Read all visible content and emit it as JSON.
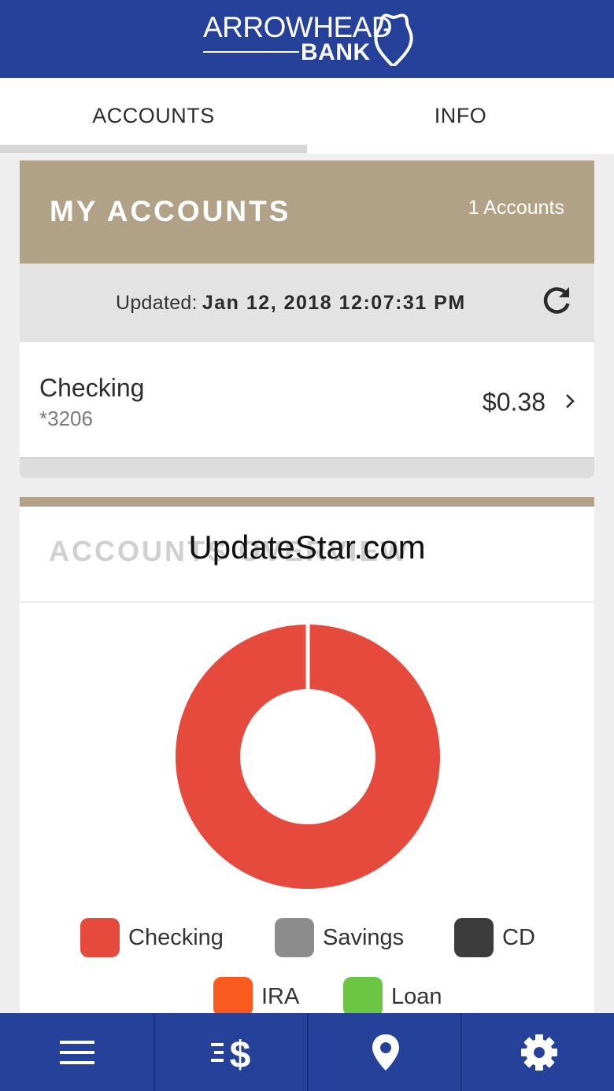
{
  "brand": {
    "name_top": "ARROWHEAD",
    "name_bottom": "BANK",
    "color": "#26419a",
    "accent": "#b1a287"
  },
  "tabs": [
    {
      "label": "ACCOUNTS",
      "active": true
    },
    {
      "label": "INFO",
      "active": false
    }
  ],
  "my_accounts": {
    "title": "MY ACCOUNTS",
    "count": "1 Accounts",
    "updated_label": "Updated:",
    "updated_value": "Jan 12, 2018 12:07:31 PM",
    "refresh_icon": "refresh-icon",
    "accounts": [
      {
        "name": "Checking",
        "number": "*3206",
        "balance": "$0.38"
      }
    ]
  },
  "overview": {
    "title": "ACCOUNTS OVERVIEW",
    "legend": [
      {
        "label": "Checking",
        "color": "#e64a3c"
      },
      {
        "label": "Savings",
        "color": "#8c8c8c"
      },
      {
        "label": "CD",
        "color": "#3c3c3c"
      },
      {
        "label": "IRA",
        "color": "#fa5a1e"
      },
      {
        "label": "Loan",
        "color": "#6cc644"
      }
    ]
  },
  "chart_data": {
    "type": "pie",
    "categories": [
      "Checking",
      "Savings",
      "CD",
      "IRA",
      "Loan"
    ],
    "values": [
      0.38,
      0,
      0,
      0,
      0
    ],
    "colors": [
      "#e64a3c",
      "#8c8c8c",
      "#3c3c3c",
      "#fa5a1e",
      "#6cc644"
    ],
    "donut": true,
    "legend": "bottom"
  },
  "watermark": "UpdateStar.com",
  "bottom_nav": [
    {
      "icon": "menu-icon"
    },
    {
      "icon": "transfer-money-icon"
    },
    {
      "icon": "location-pin-icon"
    },
    {
      "icon": "gear-icon"
    }
  ]
}
